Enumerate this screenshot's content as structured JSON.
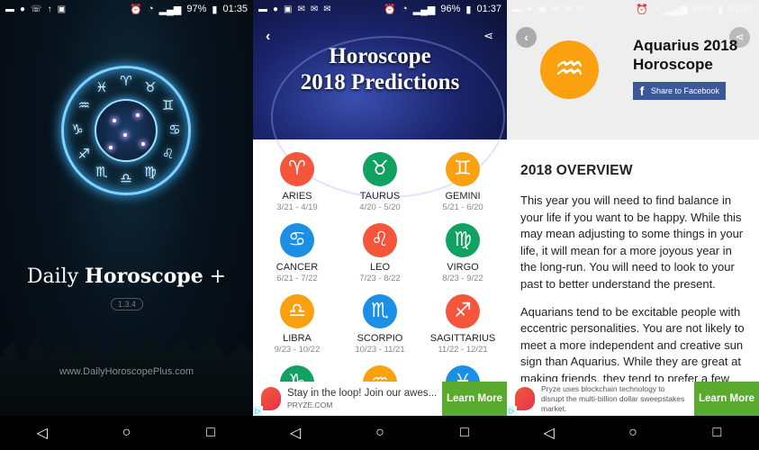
{
  "panel1": {
    "status": {
      "battery": "97%",
      "time": "01:35"
    },
    "zodiac_ring": [
      "♈",
      "♉",
      "♊",
      "♋",
      "♌",
      "♍",
      "♎",
      "♏",
      "♐",
      "♑",
      "♒",
      "♓"
    ],
    "title_regular": "Daily ",
    "title_bold": "Horoscope",
    "title_suffix": " +",
    "version": "1.3.4",
    "url": "www.DailyHoroscopePlus.com"
  },
  "panel2": {
    "status": {
      "battery": "96%",
      "time": "01:37"
    },
    "header_line1": "Horoscope",
    "header_line2": "2018 Predictions",
    "signs": [
      {
        "name": "ARIES",
        "dates": "3/21 - 4/19",
        "glyph": "♈",
        "color": "#f4553b"
      },
      {
        "name": "TAURUS",
        "dates": "4/20 - 5/20",
        "glyph": "♉",
        "color": "#11a161"
      },
      {
        "name": "GEMINI",
        "dates": "5/21 - 6/20",
        "glyph": "♊",
        "color": "#fba00f"
      },
      {
        "name": "CANCER",
        "dates": "6/21 - 7/22",
        "glyph": "♋",
        "color": "#1a8fe3"
      },
      {
        "name": "LEO",
        "dates": "7/23 - 8/22",
        "glyph": "♌",
        "color": "#f4553b"
      },
      {
        "name": "VIRGO",
        "dates": "8/23 - 9/22",
        "glyph": "♍",
        "color": "#11a161"
      },
      {
        "name": "LIBRA",
        "dates": "9/23 - 10/22",
        "glyph": "♎",
        "color": "#fba00f"
      },
      {
        "name": "SCORPIO",
        "dates": "10/23 - 11/21",
        "glyph": "♏",
        "color": "#1a8fe3"
      },
      {
        "name": "SAGITTARIUS",
        "dates": "11/22 - 12/21",
        "glyph": "♐",
        "color": "#f4553b"
      },
      {
        "name": "",
        "dates": "",
        "glyph": "♑",
        "color": "#11a161"
      },
      {
        "name": "",
        "dates": "",
        "glyph": "♒",
        "color": "#fba00f"
      },
      {
        "name": "",
        "dates": "",
        "glyph": "♓",
        "color": "#1a8fe3"
      }
    ],
    "ad": {
      "headline": "Stay in the loop! Join our awes...",
      "source": "PRYZE.COM",
      "cta": "Learn More"
    }
  },
  "panel3": {
    "status": {
      "battery": "96%",
      "time": "01:37"
    },
    "title": "Aquarius 2018 Horoscope",
    "glyph": "♒",
    "share_facebook": "Share to Facebook",
    "section_title": "2018 OVERVIEW",
    "paragraphs": [
      "This year you will need to find balance in your life if you want to be happy. While this may mean adjusting to some things in your life, it will mean for a more joyous year in the long-run. You will need to look to your past to better understand the present.",
      "Aquarians tend to be excitable people with eccentric personalities. You are not likely to meet a more independent and creative sun sign than Aquarius. While they are great at making friends, they tend to prefer a few close ones."
    ],
    "ad": {
      "text": "Pryze uses blockchain technology to disrupt the multi-billion dollar sweepstakes market.",
      "cta": "Learn More"
    }
  }
}
